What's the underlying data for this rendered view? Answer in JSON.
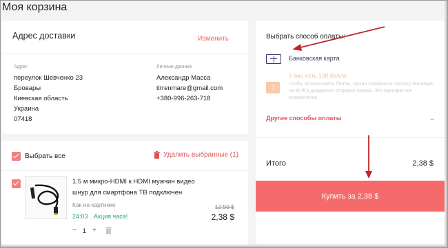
{
  "page": {
    "title": "Моя корзина"
  },
  "address": {
    "title": "Адрес доставки",
    "change_label": "Изменить",
    "address_label": "Адрес",
    "address_lines": [
      "переулок Шевченко 23",
      "Бровары",
      "Киевская область",
      "Украина",
      "07418"
    ],
    "personal_label": "Личные данные",
    "personal_lines": [
      "Александр Масса",
      "tirrenmare@gmail.com",
      "+380-996-263-718"
    ]
  },
  "cart": {
    "select_all_label": "Выбрать все",
    "delete_selected_label": "Удалить выбранные (1)",
    "item": {
      "name": "1.5 м микро-HDMI к HDMI мужчин видео шнур для смартфона ТВ подключен",
      "variant": "Как на картинке",
      "timer": "24:03",
      "promo": "Акция часа!",
      "old_price": "12,50 $",
      "price": "2,38 $",
      "quantity": "1",
      "minus": "−",
      "plus": "+"
    }
  },
  "payment": {
    "title": "Выбрать способ оплаты:",
    "bank_card_label": "Банковская карта",
    "points_title": "У вас есть 198 балла",
    "points_note": "Чтобы использовать баллы, нужно совершить покупку минимум на 60 ₴ и дождаться отправки заказа. Это однократное ограничение.",
    "other_methods_label": "Другие способы оплаты",
    "total_label": "Итого",
    "total_value": "2,38 $",
    "buy_label": "Купить за 2,38 $"
  },
  "colors": {
    "accent": "#f56b6b",
    "link": "#e0524f",
    "card_icon": "#3a3a72",
    "timer": "#2ea86a",
    "annotation_arrow": "#c0242a"
  },
  "icons": [
    "checkbox-checked-icon",
    "trash-icon",
    "card-plus-icon",
    "points-icon",
    "chevron-down-icon",
    "cable-product-image"
  ]
}
